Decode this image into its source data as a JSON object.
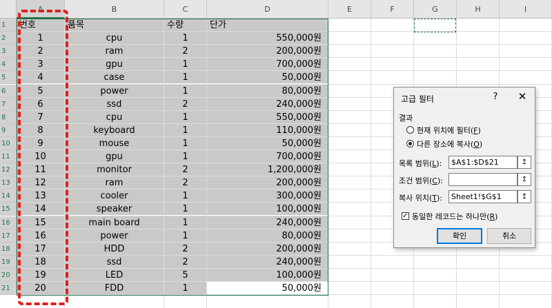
{
  "columns": [
    "A",
    "B",
    "C",
    "D",
    "E",
    "F",
    "G",
    "H",
    "I"
  ],
  "rows": [
    "1",
    "2",
    "3",
    "4",
    "5",
    "6",
    "7",
    "8",
    "9",
    "10",
    "11",
    "12",
    "13",
    "14",
    "15",
    "16",
    "17",
    "18",
    "19",
    "20",
    "21"
  ],
  "headers": {
    "no": "번호",
    "item": "품목",
    "qty": "수량",
    "price": "단가"
  },
  "data": [
    {
      "no": "1",
      "item": "cpu",
      "qty": "1",
      "price": "550,000원"
    },
    {
      "no": "2",
      "item": "ram",
      "qty": "2",
      "price": "200,000원"
    },
    {
      "no": "3",
      "item": "gpu",
      "qty": "1",
      "price": "700,000원"
    },
    {
      "no": "4",
      "item": "case",
      "qty": "1",
      "price": "50,000원"
    },
    {
      "no": "5",
      "item": "power",
      "qty": "1",
      "price": "80,000원"
    },
    {
      "no": "6",
      "item": "ssd",
      "qty": "2",
      "price": "240,000원"
    },
    {
      "no": "7",
      "item": "cpu",
      "qty": "1",
      "price": "550,000원"
    },
    {
      "no": "8",
      "item": "keyboard",
      "qty": "1",
      "price": "110,000원"
    },
    {
      "no": "9",
      "item": "mouse",
      "qty": "1",
      "price": "50,000원"
    },
    {
      "no": "10",
      "item": "gpu",
      "qty": "1",
      "price": "700,000원"
    },
    {
      "no": "11",
      "item": "monitor",
      "qty": "2",
      "price": "1,200,000원"
    },
    {
      "no": "12",
      "item": "ram",
      "qty": "2",
      "price": "200,000원"
    },
    {
      "no": "13",
      "item": "cooler",
      "qty": "1",
      "price": "300,000원"
    },
    {
      "no": "14",
      "item": "speaker",
      "qty": "1",
      "price": "100,000원"
    },
    {
      "no": "15",
      "item": "main board",
      "qty": "1",
      "price": "240,000원"
    },
    {
      "no": "16",
      "item": "power",
      "qty": "1",
      "price": "80,000원"
    },
    {
      "no": "17",
      "item": "HDD",
      "qty": "2",
      "price": "200,000원"
    },
    {
      "no": "18",
      "item": "ssd",
      "qty": "2",
      "price": "240,000원"
    },
    {
      "no": "19",
      "item": "LED",
      "qty": "5",
      "price": "100,000원"
    },
    {
      "no": "20",
      "item": "FDD",
      "qty": "1",
      "price": "50,000원"
    }
  ],
  "dialog": {
    "title": "고급 필터",
    "help": "?",
    "close": "✕",
    "result_label": "결과",
    "radio_filter_in_place": "현재 위치에 필터",
    "radio_filter_in_place_key": "F",
    "radio_copy_to": "다른 장소에 복사",
    "radio_copy_to_key": "O",
    "selected_radio": "copy_to",
    "list_range_label": "목록 범위",
    "list_range_key": "L",
    "list_range_value": "$A$1:$D$21",
    "criteria_range_label": "조건 범위",
    "criteria_range_key": "C",
    "criteria_range_value": "",
    "copy_to_label": "복사 위치",
    "copy_to_key": "T",
    "copy_to_value": "Sheet1!$G$1",
    "ref_icon": "↥",
    "unique_label": "동일한 레코드는 하나만",
    "unique_key": "R",
    "unique_checked": true,
    "check_mark": "✓",
    "ok": "확인",
    "cancel": "취소"
  },
  "colors": {
    "accent": "#217346",
    "shade": "#c9c9c9",
    "annotation": "#e0201f",
    "default_button_border": "#0078d7"
  }
}
